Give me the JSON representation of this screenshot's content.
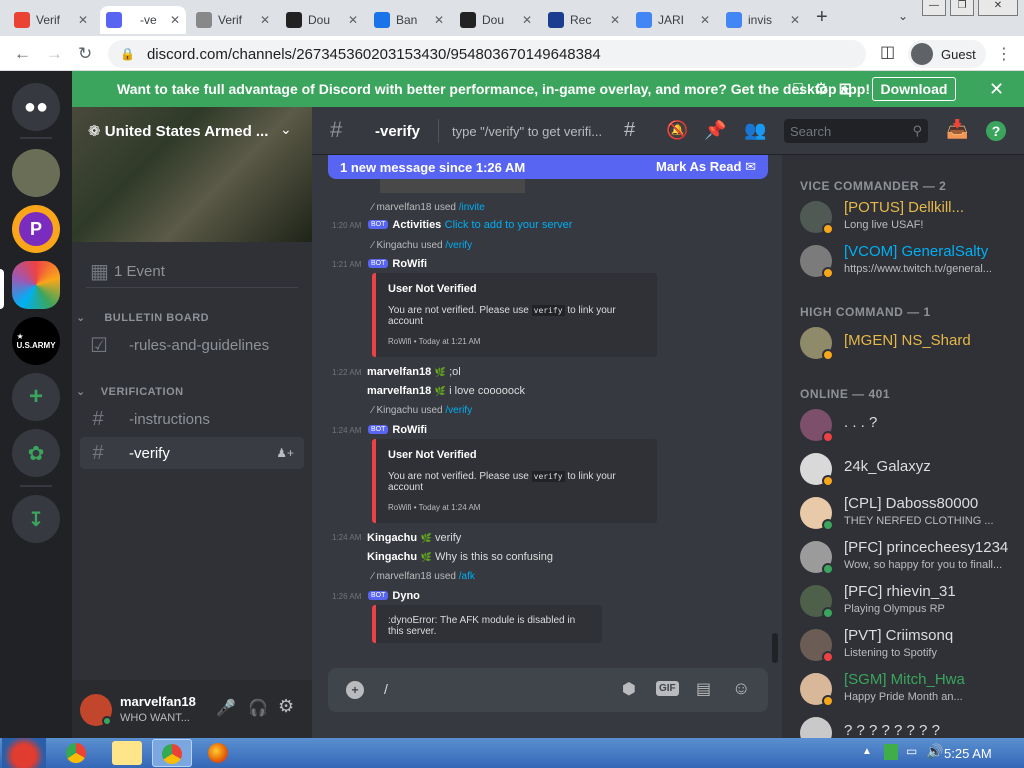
{
  "browser": {
    "tabs": [
      {
        "label": "Verif",
        "favicon": "gmail-icon",
        "color": "#ea4335"
      },
      {
        "label": " -ve",
        "favicon": "discord-icon",
        "color": "#5865f2",
        "active": true
      },
      {
        "label": "Verif",
        "favicon": "page-icon",
        "color": "#888888"
      },
      {
        "label": "Dou",
        "favicon": "record-icon",
        "color": "#222222"
      },
      {
        "label": "Ban",
        "favicon": "diamond-icon",
        "color": "#1a73e8"
      },
      {
        "label": "Dou",
        "favicon": "record-icon",
        "color": "#222222"
      },
      {
        "label": "Rec",
        "favicon": "picture-icon",
        "color": "#1a3d8f"
      },
      {
        "label": "JARI",
        "favicon": "google-icon",
        "color": "#4285f4"
      },
      {
        "label": "invis",
        "favicon": "google-icon",
        "color": "#4285f4"
      }
    ],
    "url": "discord.com/channels/267345360203153430/954803670149648384",
    "profile": "Guest"
  },
  "banner": {
    "text": "Want to take full advantage of Discord with better performance, in-game overlay, and more? Get the desktop app!",
    "download": "Download"
  },
  "server": {
    "name": "United States Armed ...",
    "event": "1 Event",
    "categories": [
      "  BULLETIN BOARD  ",
      " VERIFICATION "
    ],
    "channels": [
      {
        "name": " -rules-and-guidelines",
        "icon": "rules-icon"
      },
      {
        "name": " -instructions",
        "icon": "hash-icon"
      },
      {
        "name": " -verify",
        "icon": "hash-icon",
        "selected": true
      }
    ]
  },
  "user": {
    "name": "marvelfan18",
    "status": "WHO WANT..."
  },
  "chat": {
    "channel": " -verify",
    "topic": "type \"/verify\" to get verifi...",
    "search": "Search",
    "new_messages": "1 new message since 1:26 AM",
    "mark_read": "Mark As Read",
    "messages": [
      {
        "ts": "1:20 AM",
        "reply_user": "marvelfan18",
        "used": "used",
        "cmd": "/invite",
        "bot": "BOT",
        "author": "Activities",
        "text": "Click to add to your server"
      },
      {
        "ts": "1:21 AM",
        "reply_user": "Kingachu",
        "used": "used",
        "cmd": "/verify",
        "bot": "BOT",
        "author": "RoWifi",
        "embed": {
          "title": "User Not Verified",
          "desc_a": "You are not verified. Please use",
          "code": "verify",
          "desc_b": "to link your account",
          "footer": "RoWifi • Today at 1:21 AM"
        }
      },
      {
        "ts": "1:22 AM",
        "author": "marvelfan18",
        "text": ";ol"
      },
      {
        "author": "marvelfan18",
        "text": "i love cooooock"
      },
      {
        "ts": "1:24 AM",
        "reply_user": "Kingachu",
        "used": "used",
        "cmd": "/verify",
        "bot": "BOT",
        "author": "RoWifi",
        "embed": {
          "title": "User Not Verified",
          "desc_a": "You are not verified. Please use",
          "code": "verify",
          "desc_b": "to link your account",
          "footer": "RoWifi • Today at 1:24 AM"
        }
      },
      {
        "ts": "1:24 AM",
        "author": "Kingachu",
        "text": "verify"
      },
      {
        "author": "Kingachu",
        "text": "Why is this so confusing"
      },
      {
        "ts": "1:26 AM",
        "reply_user": "marvelfan18",
        "used": "used",
        "cmd": "/afk",
        "bot": "BOT",
        "author": "Dyno",
        "embed": {
          "desc": ":dynoError: The AFK module is disabled in this server."
        }
      }
    ],
    "composer": "/"
  },
  "members": {
    "groups": [
      {
        "title": "VICE COMMANDER — 2",
        "members": [
          {
            "name": "[POTUS] Dellkill...",
            "sub": "Long live USAF!",
            "color": "#e6b84a",
            "status": "idle"
          },
          {
            "name": "[VCOM] GeneralSalty",
            "sub": "https://www.twitch.tv/general...",
            "color": "#00b0f4",
            "status": "idle"
          }
        ]
      },
      {
        "title": "HIGH COMMAND — 1",
        "members": [
          {
            "name": "[MGEN] NS_Shard",
            "sub": "",
            "color": "#e6b84a",
            "status": "idle"
          }
        ]
      },
      {
        "title": "ONLINE — 401",
        "members": [
          {
            "name": ". . . ?",
            "sub": "",
            "color": "#dcddde",
            "status": "dnd"
          },
          {
            "name": "24k_Galaxyz",
            "sub": "",
            "color": "#dcddde",
            "status": "idle"
          },
          {
            "name": "[CPL] Daboss80000",
            "sub": "THEY NERFED CLOTHING ...",
            "color": "#dcddde",
            "status": "online"
          },
          {
            "name": "[PFC] princecheesy1234",
            "sub": "Wow, so happy for you to finall...",
            "color": "#dcddde",
            "status": "online"
          },
          {
            "name": "[PFC] rhievin_31",
            "sub": "Playing Olympus RP",
            "color": "#dcddde",
            "status": "online"
          },
          {
            "name": "[PVT] Criimsonq",
            "sub": "Listening to Spotify",
            "color": "#dcddde",
            "status": "dnd"
          },
          {
            "name": "[SGM] Mitch_Hwa",
            "sub": "Happy Pride Month an...",
            "color": "#3ba55d",
            "status": "idle"
          },
          {
            "name": "? ? ? ? ? ? ? ?",
            "sub": "",
            "color": "#dcddde",
            "status": "idle"
          }
        ]
      }
    ]
  },
  "taskbar": {
    "time": "5:25 AM"
  }
}
